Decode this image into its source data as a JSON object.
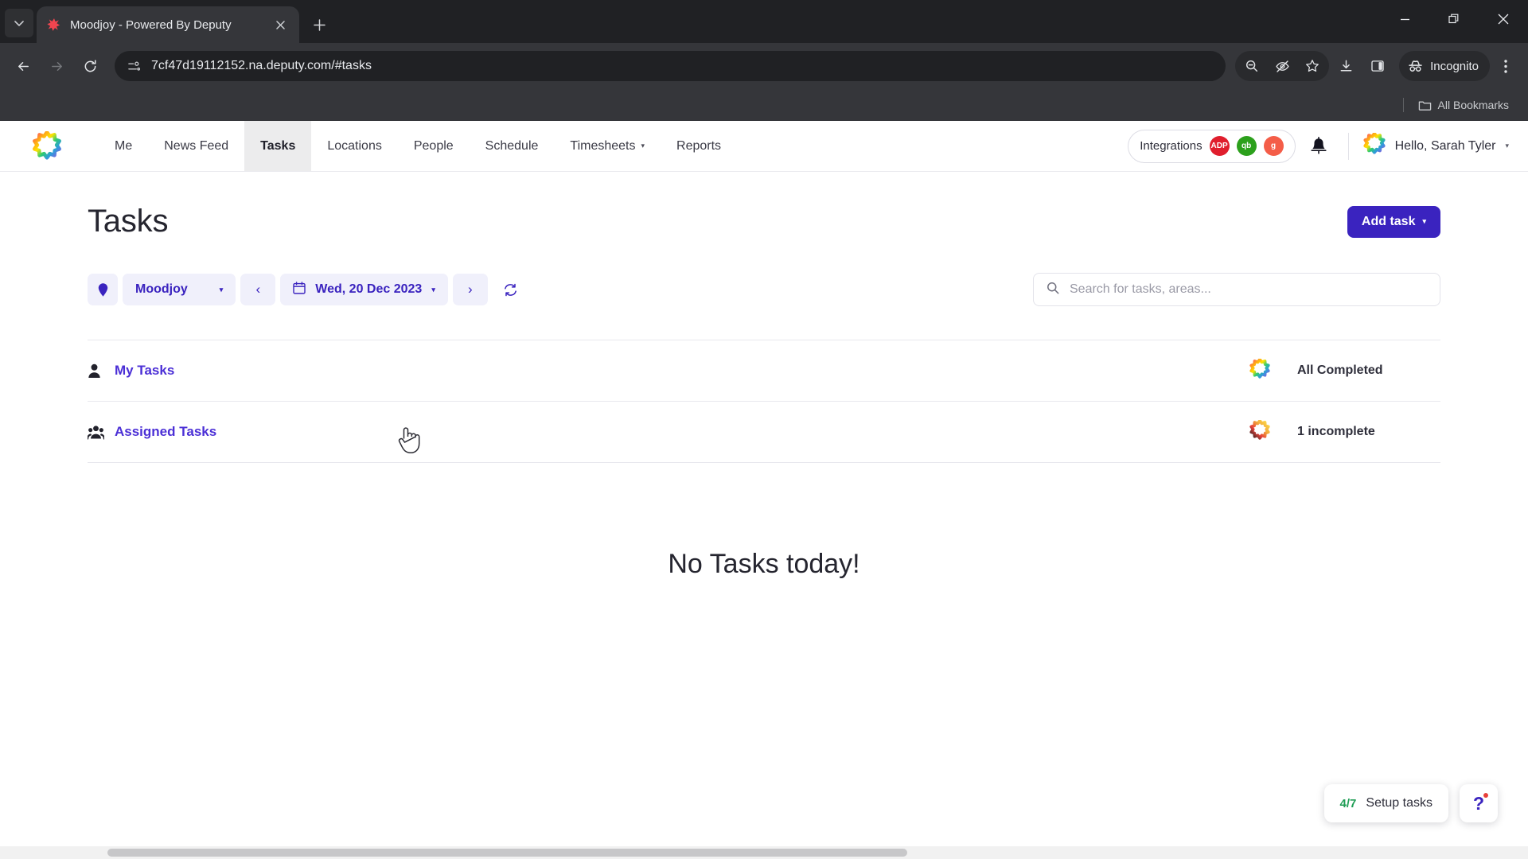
{
  "browser": {
    "tab": {
      "title": "Moodjoy - Powered By Deputy",
      "favicon_name": "deputy-star-favicon",
      "close_label": "×"
    },
    "new_tab_label": "+",
    "tab_search_label": "⌄",
    "window_controls": {
      "minimize": "—",
      "restore": "❐",
      "close": "✕"
    },
    "nav": {
      "back": "←",
      "forward": "→",
      "reload": "⟳"
    },
    "omnibox": {
      "url": "7cf47d19112152.na.deputy.com/#tasks",
      "site_info_icon": "site-settings-icon"
    },
    "toolbar_icons": [
      "zoom-out-icon",
      "eye-slash-icon",
      "bookmark-star-icon",
      "download-icon",
      "side-panel-icon"
    ],
    "incognito_label": "Incognito",
    "menu_label": "⋮",
    "bookmarks": {
      "all_bookmarks_label": "All Bookmarks"
    }
  },
  "app": {
    "logo_name": "deputy-rainbow-logo",
    "nav_items": [
      {
        "label": "Me",
        "active": false,
        "has_caret": false
      },
      {
        "label": "News Feed",
        "active": false,
        "has_caret": false
      },
      {
        "label": "Tasks",
        "active": true,
        "has_caret": false
      },
      {
        "label": "Locations",
        "active": false,
        "has_caret": false
      },
      {
        "label": "People",
        "active": false,
        "has_caret": false
      },
      {
        "label": "Schedule",
        "active": false,
        "has_caret": false
      },
      {
        "label": "Timesheets",
        "active": false,
        "has_caret": true
      },
      {
        "label": "Reports",
        "active": false,
        "has_caret": false
      }
    ],
    "integrations": {
      "label": "Integrations",
      "badges": [
        {
          "name": "adp-integration-badge",
          "text": "ADP",
          "color": "#e01e2d"
        },
        {
          "name": "quickbooks-integration-badge",
          "text": "qb",
          "color": "#2ca01c"
        },
        {
          "name": "gusto-integration-badge",
          "text": "g",
          "color": "#f45d48"
        }
      ]
    },
    "notifications_icon": "bell-icon",
    "user": {
      "greeting": "Hello, Sarah Tyler",
      "avatar_name": "user-avatar-star",
      "caret": "▾"
    }
  },
  "main": {
    "title": "Tasks",
    "add_task": {
      "label": "Add task",
      "caret": "▾",
      "color": "#3a23bf"
    },
    "toolbar": {
      "location_pin_icon": "location-pin-icon",
      "location": {
        "value": "Moodjoy",
        "caret": "▾"
      },
      "prev_label": "‹",
      "next_label": "›",
      "date": {
        "value": "Wed, 20 Dec 2023",
        "calendar_icon": "calendar-icon",
        "caret": "▾"
      },
      "refresh_label": "⟳"
    },
    "search": {
      "placeholder": "Search for tasks, areas...",
      "value": "",
      "icon": "search-icon"
    },
    "task_groups": [
      {
        "icon": "single-user-icon",
        "label": "My Tasks",
        "status_icon": "deputy-star-complete",
        "status": "All Completed"
      },
      {
        "icon": "group-users-icon",
        "label": "Assigned Tasks",
        "status_icon": "deputy-star-partial",
        "status": "1 incomplete"
      }
    ],
    "empty_state": "No Tasks today!"
  },
  "widgets": {
    "setup": {
      "fraction": "4/7",
      "label": "Setup tasks"
    },
    "help": {
      "glyph": "?",
      "name": "help-button",
      "has_badge": true
    }
  }
}
